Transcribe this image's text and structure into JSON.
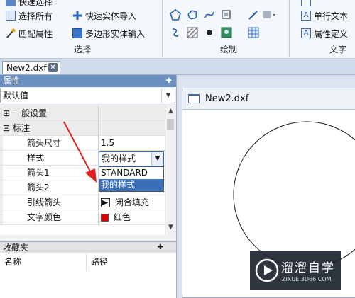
{
  "ribbon": {
    "select_group": {
      "label": "选择",
      "buttons": [
        {
          "label": "快速选择",
          "icon": "quick-select-icon"
        },
        {
          "label": "选择所有",
          "icon": "select-all-icon"
        },
        {
          "label": "匹配属性",
          "icon": "match-properties-icon"
        },
        {
          "label": "快速实体导入",
          "icon": "quick-entity-import-icon"
        },
        {
          "label": "多边形实体输入",
          "icon": "polygon-entity-input-icon"
        }
      ]
    },
    "draw_group": {
      "label": "绘制"
    },
    "text_group": {
      "label": "文字",
      "buttons": [
        {
          "label": "单行文本",
          "icon": "single-line-text-icon"
        },
        {
          "label": "属性定义",
          "icon": "attribute-definition-icon"
        }
      ]
    }
  },
  "document_tabs": [
    {
      "label": "New2.dxf"
    }
  ],
  "properties_panel": {
    "title": "属性",
    "default_combo": "默认值",
    "categories": [
      {
        "label": "一般设置",
        "expander": "⊞"
      },
      {
        "label": "标注",
        "expander": "⊟"
      }
    ],
    "rows": [
      {
        "name": "箭头尺寸",
        "value": "1.5"
      },
      {
        "name": "样式",
        "value": "我的样式"
      },
      {
        "name": "箭头1",
        "value": ""
      },
      {
        "name": "箭头2",
        "value": ""
      },
      {
        "name": "引线箭头",
        "value": "闭合填充"
      },
      {
        "name": "文字颜色",
        "value": "红色"
      }
    ],
    "style_dropdown": {
      "options": [
        "STANDARD",
        "我的样式"
      ],
      "selected": "我的样式"
    },
    "colors": {
      "text_color_swatch": "#e00000",
      "annotation_arrow": "#e02020",
      "selection": "#3a6fb8"
    }
  },
  "favorites_panel": {
    "title": "收藏夹",
    "columns": [
      "名称",
      "路径"
    ]
  },
  "drawing_window": {
    "title": "New2.dxf"
  },
  "watermark": {
    "brand": "溜溜自学",
    "url": "ZIXUE.3D66.COM"
  }
}
